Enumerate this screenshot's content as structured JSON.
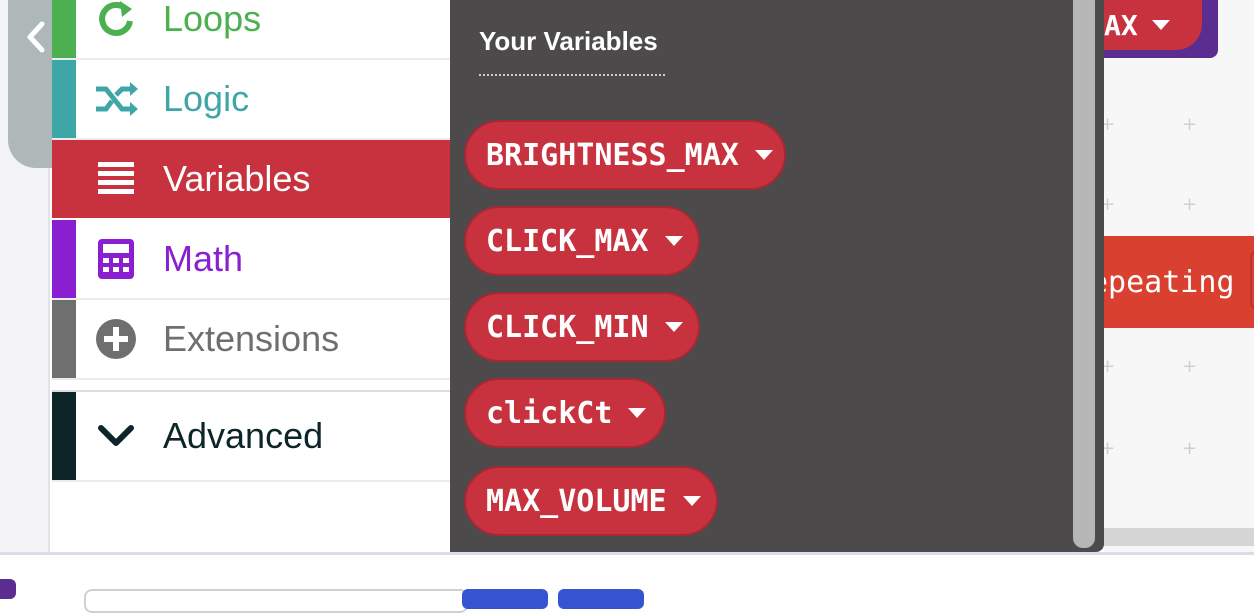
{
  "toolbox": {
    "categories": [
      {
        "label": "Loops",
        "icon": "loop-icon",
        "color": "#4caf50"
      },
      {
        "label": "Logic",
        "icon": "shuffle-icon",
        "color": "#3fa6a7"
      },
      {
        "label": "Variables",
        "icon": "list-icon",
        "color": "#c8313e"
      },
      {
        "label": "Math",
        "icon": "calculator-icon",
        "color": "#8a1fd1"
      },
      {
        "label": "Extensions",
        "icon": "plus-circle-icon",
        "color": "#6f6f6f"
      },
      {
        "label": "Advanced",
        "icon": "chevron-down-icon",
        "color": "#0d2529"
      }
    ]
  },
  "flyout": {
    "title": "Your Variables",
    "variables": [
      "BRIGHTNESS_MAX",
      "CLICK_MAX",
      "CLICK_MIN",
      "clickCt",
      "MAX_VOLUME"
    ]
  },
  "workspace": {
    "top_block_text": "AX",
    "orange_block_text": "epeating"
  },
  "colors": {
    "variables_accent": "#c8313e",
    "flyout_background": "#4c4a4b"
  }
}
